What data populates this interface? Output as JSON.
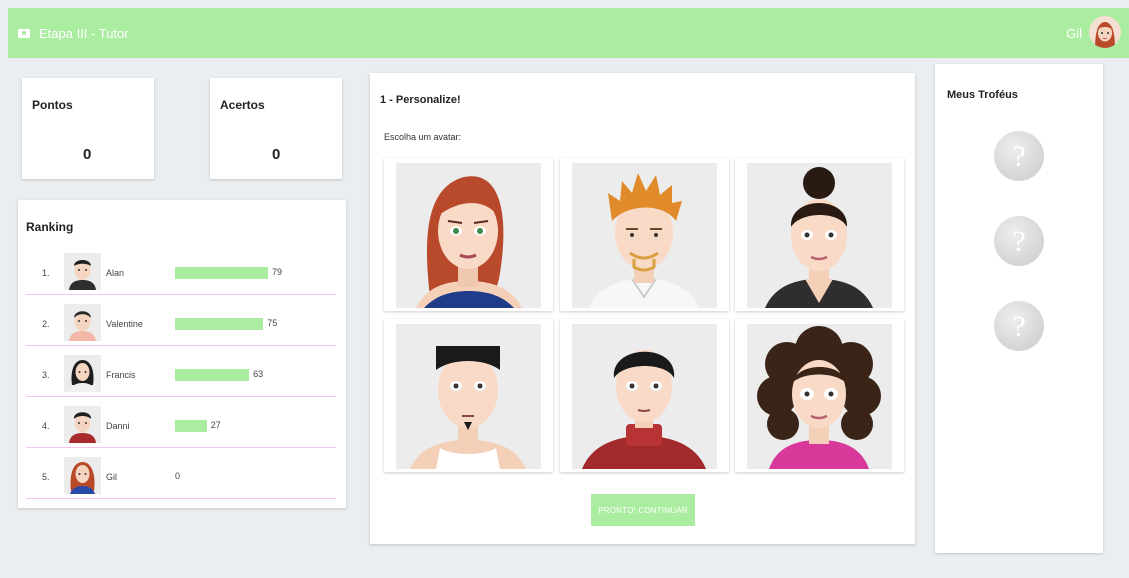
{
  "header": {
    "title": "Etapa III - Tutor",
    "user_name": "Gil"
  },
  "stats": [
    {
      "label": "Pontos",
      "value": "0"
    },
    {
      "label": "Acertos",
      "value": "0"
    }
  ],
  "ranking": {
    "title": "Ranking",
    "rows": [
      {
        "pos": "1.",
        "name": "Alan",
        "score": "79",
        "progress": 79
      },
      {
        "pos": "2.",
        "name": "Valentine",
        "score": "75",
        "progress": 75
      },
      {
        "pos": "3.",
        "name": "Francis",
        "score": "63",
        "progress": 63
      },
      {
        "pos": "4.",
        "name": "Danni",
        "score": "27",
        "progress": 27
      },
      {
        "pos": "5.",
        "name": "Gil",
        "score": "0",
        "progress": 0
      }
    ]
  },
  "personalize": {
    "title": "1 - Personalize!",
    "subtitle": "Escolha um avatar:",
    "button_label": "PRONTO! CONTINUAR"
  },
  "trophies": {
    "title": "Meus Troféus",
    "items": [
      "?",
      "?",
      "?"
    ]
  },
  "colors": {
    "accent": "#abeda0",
    "divider": "#f2c6ee",
    "placeholder": "#ececec"
  }
}
